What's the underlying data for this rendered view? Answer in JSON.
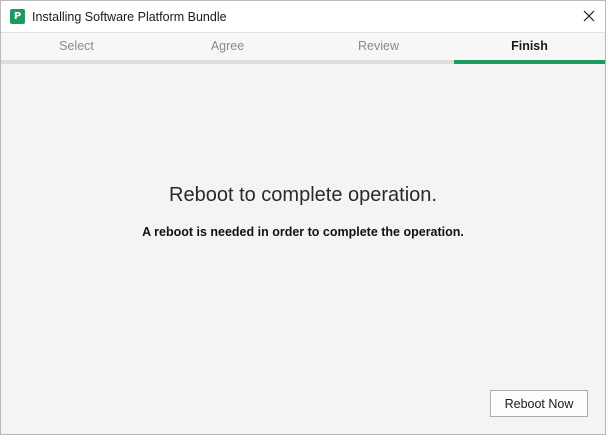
{
  "window": {
    "title": "Installing Software Platform Bundle",
    "icon_letter": "P",
    "icon_color": "#1e9a61",
    "close_icon": "close-icon"
  },
  "tabs": [
    {
      "label": "Select",
      "active": false
    },
    {
      "label": "Agree",
      "active": false
    },
    {
      "label": "Review",
      "active": false
    },
    {
      "label": "Finish",
      "active": true
    }
  ],
  "main": {
    "heading": "Reboot to complete operation.",
    "message": "A reboot is needed in order to complete the operation.",
    "reboot_button_label": "Reboot Now"
  },
  "colors": {
    "accent": "#1e9a61",
    "inactive_tab_bar": "#dedede",
    "background": "#f4f4f4"
  }
}
